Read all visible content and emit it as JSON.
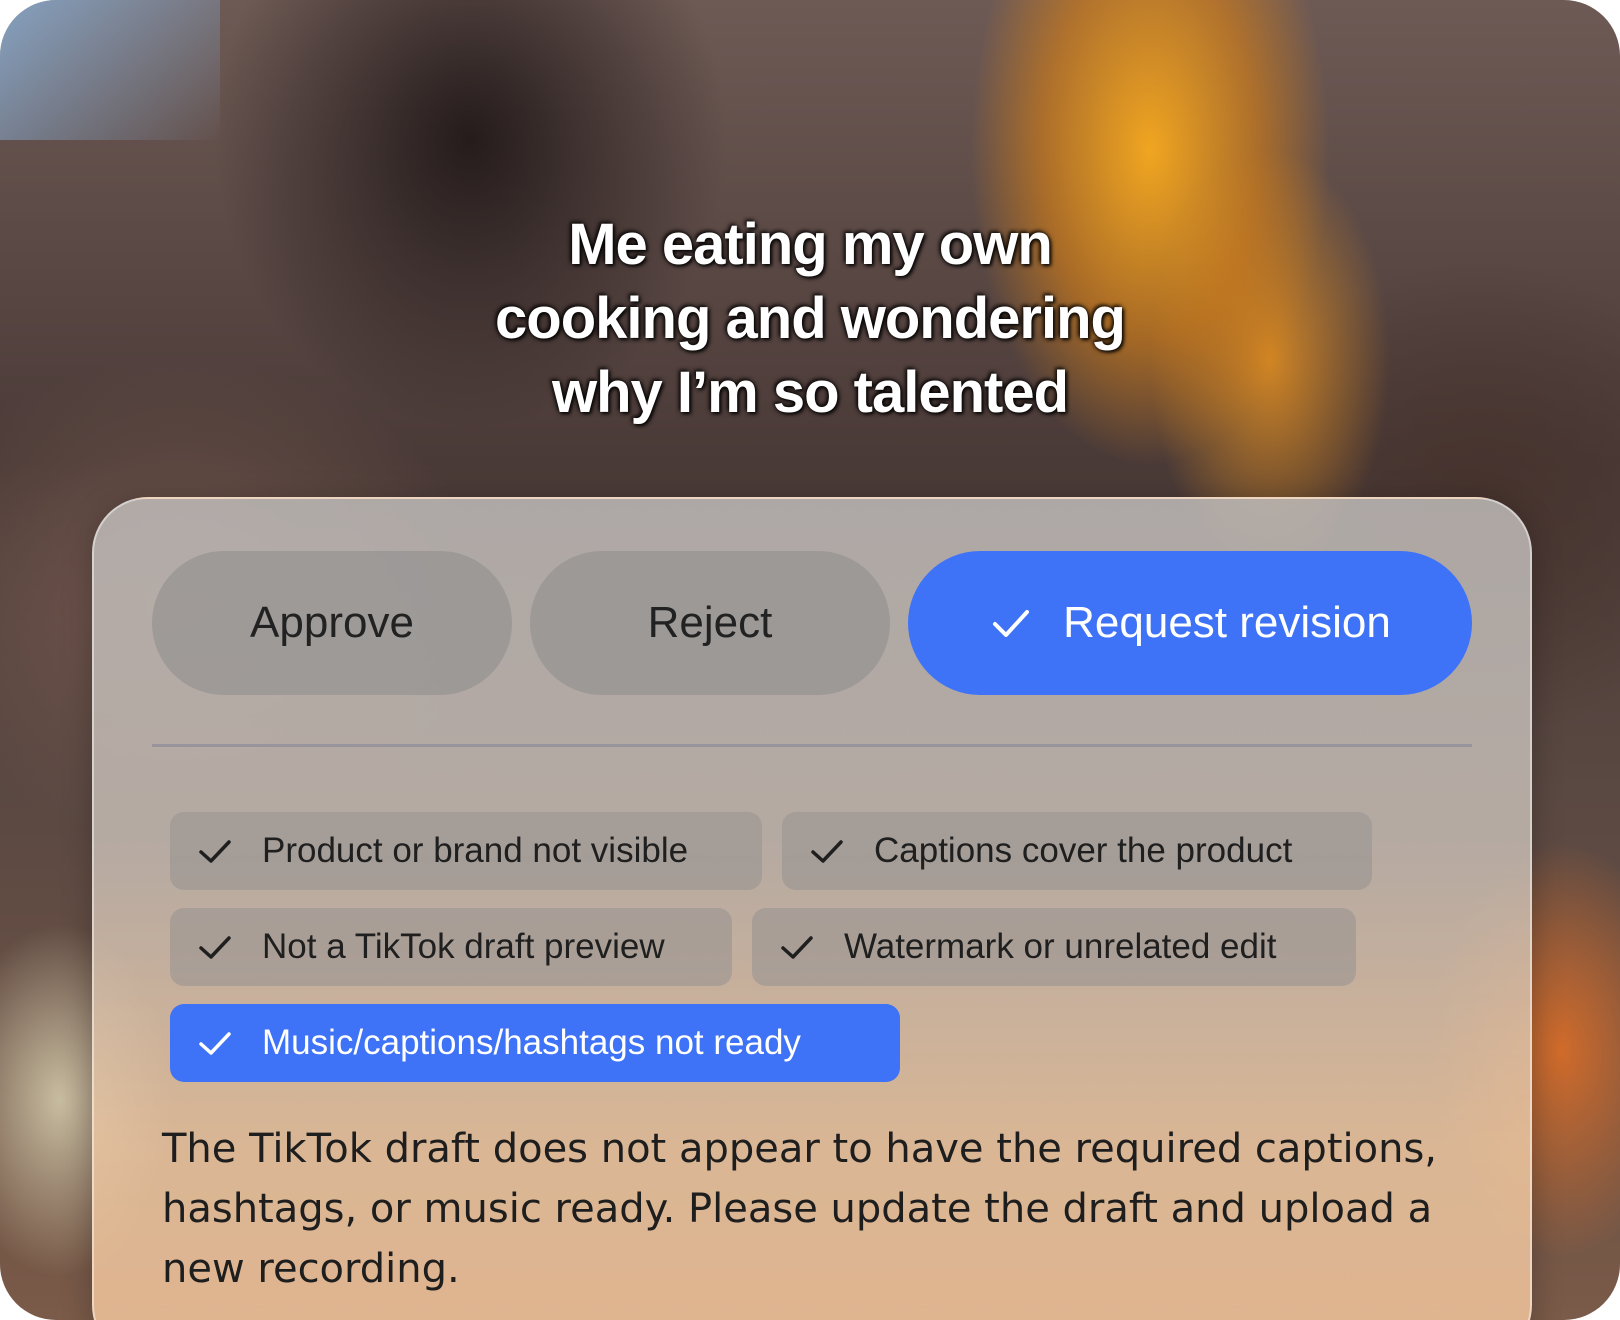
{
  "video": {
    "caption_lines": [
      "Me eating my own",
      "cooking and wondering",
      "why I’m so talented"
    ]
  },
  "decision": {
    "approve_label": "Approve",
    "reject_label": "Reject",
    "revision_label": "Request revision",
    "selected": "Request revision",
    "selected_color": "#3f73f7"
  },
  "reasons": [
    {
      "label": "Product or brand not visible",
      "selected": false
    },
    {
      "label": "Captions cover the product",
      "selected": false
    },
    {
      "label": "Not a TikTok draft preview",
      "selected": false
    },
    {
      "label": "Watermark or unrelated edit",
      "selected": false
    },
    {
      "label": "Music/captions/hashtags not ready",
      "selected": true
    }
  ],
  "feedback_text": "The TikTok draft does not appear to have the required captions, hashtags, or music ready. Please update the draft and upload a new recording.",
  "icons": {
    "check": "check-icon"
  }
}
